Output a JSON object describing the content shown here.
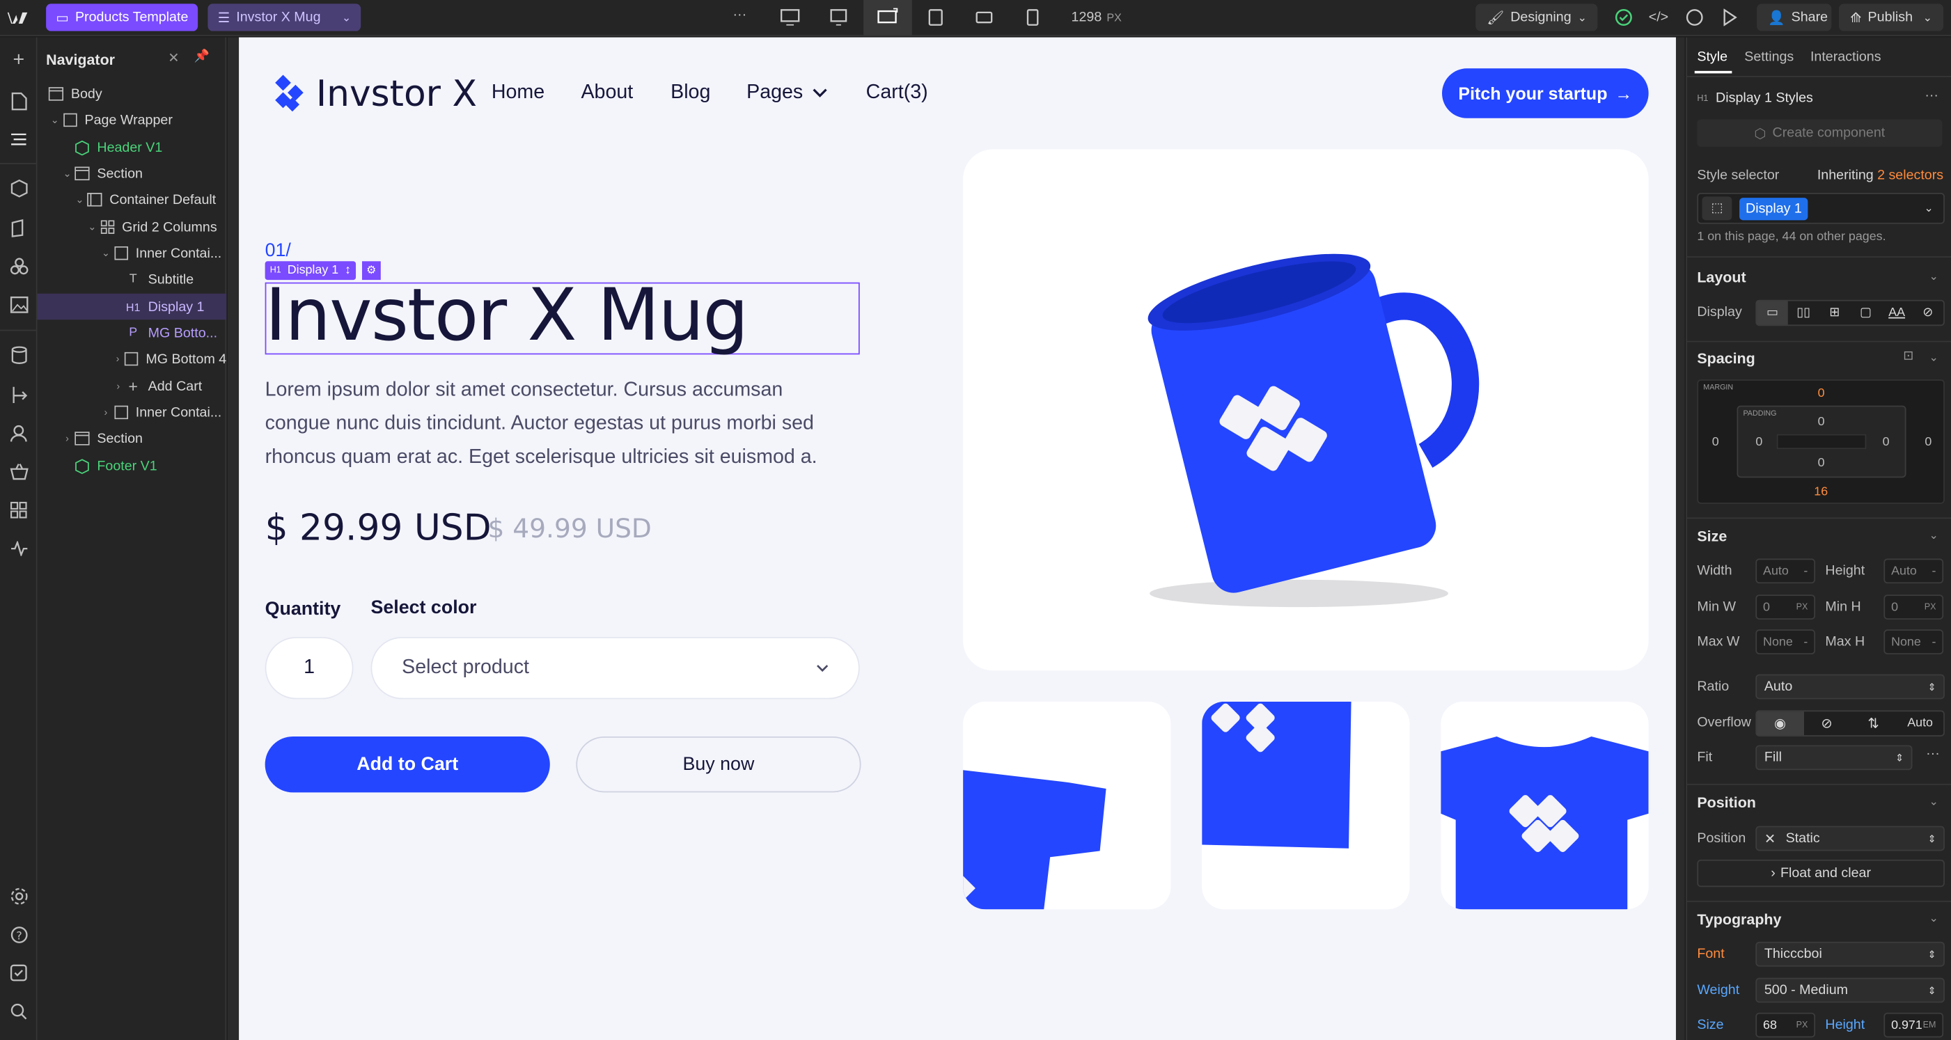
{
  "topbar": {
    "page_pill": "Products Template",
    "collection_pill": "Invstor X Mug",
    "more": "···",
    "width_value": "1298",
    "width_unit": "PX",
    "mode": "Designing",
    "share": "Share",
    "publish": "Publish"
  },
  "navigator": {
    "title": "Navigator",
    "items": [
      {
        "label": "Body"
      },
      {
        "label": "Page Wrapper"
      },
      {
        "label": "Header V1"
      },
      {
        "label": "Section"
      },
      {
        "label": "Container Default"
      },
      {
        "label": "Grid 2 Columns"
      },
      {
        "label": "Inner Contai..."
      },
      {
        "label": "Subtitle"
      },
      {
        "label": "Display 1"
      },
      {
        "label": "MG Botto..."
      },
      {
        "label": "MG Bottom 4"
      },
      {
        "label": "Add Cart"
      },
      {
        "label": "Inner Contai..."
      },
      {
        "label": "Section"
      },
      {
        "label": "Footer V1"
      }
    ],
    "tag_h1": "H1",
    "tag_p": "P",
    "tag_t": "T"
  },
  "site": {
    "brand": "Invstor X",
    "nav": [
      "Home",
      "About",
      "Blog",
      "Pages",
      "Cart(3)"
    ],
    "cta": "Pitch your startup",
    "subtitle": "01/",
    "selection_label": "Display 1",
    "title": "Invstor X Mug",
    "description": "Lorem ipsum dolor sit amet consectetur. Cursus accumsan congue nunc duis tincidunt. Auctor egestas ut purus morbi sed rhoncus quam erat ac. Eget scelerisque ultricies sit euismod a.",
    "price": "$ 29.99 USD",
    "old_price": "$ 49.99 USD",
    "quantity_label": "Quantity",
    "color_label": "Select color",
    "quantity_value": "1",
    "select_placeholder": "Select product",
    "add_to_cart": "Add to Cart",
    "buy_now": "Buy now"
  },
  "style_panel": {
    "tabs": [
      "Style",
      "Settings",
      "Interactions"
    ],
    "tag": "H1",
    "styles_title": "Display 1 Styles",
    "create_component": "Create component",
    "style_selector_label": "Style selector",
    "inheriting": "Inheriting",
    "inheriting_count": "2 selectors",
    "selector_chip": "Display 1",
    "usage_note": "1 on this page, 44 on other pages.",
    "layout_title": "Layout",
    "display_label": "Display",
    "display_text_option": "AA",
    "spacing_title": "Spacing",
    "margin_label": "MARGIN",
    "padding_label": "PADDING",
    "margin_top": "0",
    "margin_right": "0",
    "margin_bottom": "16",
    "margin_left": "0",
    "padding_top": "0",
    "padding_right": "0",
    "padding_bottom": "0",
    "padding_left": "0",
    "size_title": "Size",
    "width_label": "Width",
    "width_value": "Auto",
    "height_label": "Height",
    "height_value": "Auto",
    "minw_label": "Min W",
    "minw_value": "0",
    "minh_label": "Min H",
    "minh_value": "0",
    "maxw_label": "Max W",
    "maxw_value": "None",
    "maxh_label": "Max H",
    "maxh_value": "None",
    "unit_px": "PX",
    "unit_dash": "-",
    "ratio_label": "Ratio",
    "ratio_value": "Auto",
    "overflow_label": "Overflow",
    "overflow_auto": "Auto",
    "fit_label": "Fit",
    "fit_value": "Fill",
    "position_title": "Position",
    "position_label": "Position",
    "position_value": "Static",
    "float_clear": "Float and clear",
    "typography_title": "Typography",
    "font_label": "Font",
    "font_value": "Thicccboi",
    "weight_label": "Weight",
    "weight_value": "500 - Medium",
    "size_label": "Size",
    "size_value": "68",
    "size_unit": "PX",
    "height_lbl": "Height",
    "line_height_value": "0.971",
    "line_height_unit": "EM"
  },
  "colors": {
    "brand_blue": "#2446ff",
    "editor_purple": "#7a4bff",
    "selected_chip": "#1f6feb",
    "orange": "#ff8b3d",
    "green": "#4ad37a"
  }
}
